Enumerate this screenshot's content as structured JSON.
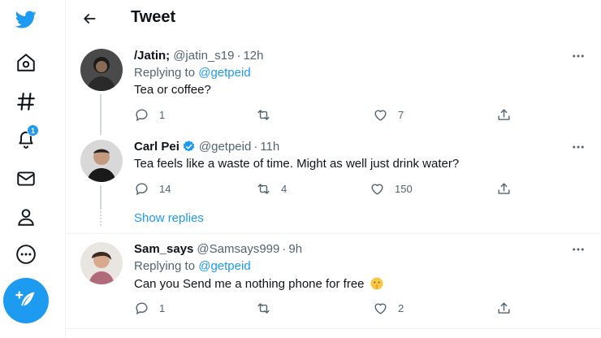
{
  "sidebar": {
    "icons": [
      "twitter-logo-icon",
      "home-icon",
      "explore-hashtag-icon",
      "notifications-bell-icon",
      "messages-mail-icon",
      "profile-person-icon",
      "more-circle-icon"
    ],
    "notification_count": "1",
    "compose_icon": "feather-plus-icon",
    "brand_color": "#1d9bf0"
  },
  "header": {
    "title": "Tweet",
    "back_icon": "arrow-left-icon"
  },
  "tweets": [
    {
      "name": "/Jatin;",
      "handle": "@jatin_s19",
      "sep": "·",
      "time": "12h",
      "replying_prefix": "Replying to",
      "replying_mention": "@getpeid",
      "text": "Tea or coffee?",
      "replies": "1",
      "retweets": "",
      "likes": "7"
    },
    {
      "name": "Carl Pei",
      "handle": "@getpeid",
      "sep": "·",
      "time": "11h",
      "verified": true,
      "text": "Tea feels like a waste of time. Might as well just drink water?",
      "replies": "14",
      "retweets": "4",
      "likes": "150"
    },
    {
      "name": "Sam_says",
      "handle": "@Samsays999",
      "sep": "·",
      "time": "9h",
      "replying_prefix": "Replying to",
      "replying_mention": "@getpeid",
      "text": "Can you Send me a nothing phone for free",
      "emoji": "shushing-face-emoji",
      "replies": "1",
      "retweets": "",
      "likes": "2"
    }
  ],
  "show_replies": "Show replies"
}
